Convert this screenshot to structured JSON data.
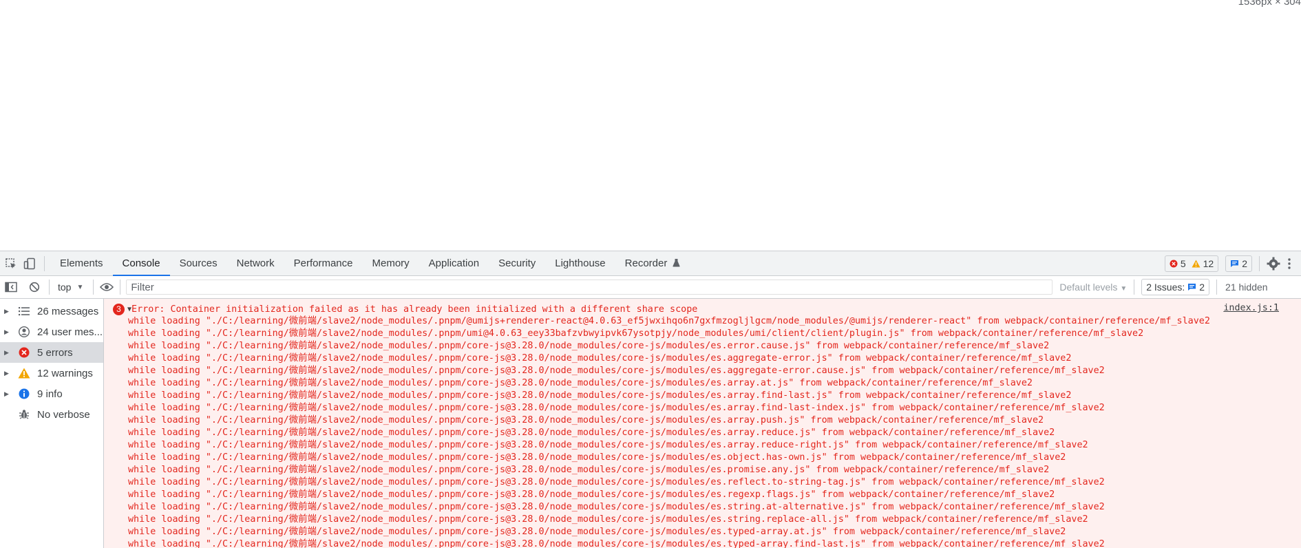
{
  "page": {
    "viewport_dims": "1536px × 304"
  },
  "tabs": {
    "items": [
      {
        "label": "Elements"
      },
      {
        "label": "Console"
      },
      {
        "label": "Sources"
      },
      {
        "label": "Network"
      },
      {
        "label": "Performance"
      },
      {
        "label": "Memory"
      },
      {
        "label": "Application"
      },
      {
        "label": "Security"
      },
      {
        "label": "Lighthouse"
      },
      {
        "label": "Recorder"
      }
    ],
    "active": "Console",
    "error_count": "5",
    "warning_count": "12",
    "message_count": "2"
  },
  "filterbar": {
    "context": "top",
    "filter_placeholder": "Filter",
    "levels": "Default levels",
    "issues_label": "2 Issues:",
    "issues_count": "2",
    "hidden": "21 hidden"
  },
  "sidebar": {
    "items": [
      {
        "label": "26 messages",
        "icon": "list-icon"
      },
      {
        "label": "24 user mes...",
        "icon": "user-icon"
      },
      {
        "label": "5 errors",
        "icon": "error-icon"
      },
      {
        "label": "12 warnings",
        "icon": "warning-icon"
      },
      {
        "label": "9 info",
        "icon": "info-icon"
      },
      {
        "label": "No verbose",
        "icon": "bug-icon"
      }
    ]
  },
  "console": {
    "error_repeat": "3",
    "error_message": "Error: Container initialization failed as it has already been initialized with a different share scope",
    "source": "index.js:1",
    "lines": [
      "while loading \"./C:/learning/微前端/slave2/node_modules/.pnpm/@umijs+renderer-react@4.0.63_ef5jwxihqo6n7gxfmzogljlgcm/node_modules/@umijs/renderer-react\" from webpack/container/reference/mf_slave2",
      "while loading \"./C:/learning/微前端/slave2/node_modules/.pnpm/umi@4.0.63_eey33bafzvbwyipvk67ysotpjy/node_modules/umi/client/client/plugin.js\" from webpack/container/reference/mf_slave2",
      "while loading \"./C:/learning/微前端/slave2/node_modules/.pnpm/core-js@3.28.0/node_modules/core-js/modules/es.error.cause.js\" from webpack/container/reference/mf_slave2",
      "while loading \"./C:/learning/微前端/slave2/node_modules/.pnpm/core-js@3.28.0/node_modules/core-js/modules/es.aggregate-error.js\" from webpack/container/reference/mf_slave2",
      "while loading \"./C:/learning/微前端/slave2/node_modules/.pnpm/core-js@3.28.0/node_modules/core-js/modules/es.aggregate-error.cause.js\" from webpack/container/reference/mf_slave2",
      "while loading \"./C:/learning/微前端/slave2/node_modules/.pnpm/core-js@3.28.0/node_modules/core-js/modules/es.array.at.js\" from webpack/container/reference/mf_slave2",
      "while loading \"./C:/learning/微前端/slave2/node_modules/.pnpm/core-js@3.28.0/node_modules/core-js/modules/es.array.find-last.js\" from webpack/container/reference/mf_slave2",
      "while loading \"./C:/learning/微前端/slave2/node_modules/.pnpm/core-js@3.28.0/node_modules/core-js/modules/es.array.find-last-index.js\" from webpack/container/reference/mf_slave2",
      "while loading \"./C:/learning/微前端/slave2/node_modules/.pnpm/core-js@3.28.0/node_modules/core-js/modules/es.array.push.js\" from webpack/container/reference/mf_slave2",
      "while loading \"./C:/learning/微前端/slave2/node_modules/.pnpm/core-js@3.28.0/node_modules/core-js/modules/es.array.reduce.js\" from webpack/container/reference/mf_slave2",
      "while loading \"./C:/learning/微前端/slave2/node_modules/.pnpm/core-js@3.28.0/node_modules/core-js/modules/es.array.reduce-right.js\" from webpack/container/reference/mf_slave2",
      "while loading \"./C:/learning/微前端/slave2/node_modules/.pnpm/core-js@3.28.0/node_modules/core-js/modules/es.object.has-own.js\" from webpack/container/reference/mf_slave2",
      "while loading \"./C:/learning/微前端/slave2/node_modules/.pnpm/core-js@3.28.0/node_modules/core-js/modules/es.promise.any.js\" from webpack/container/reference/mf_slave2",
      "while loading \"./C:/learning/微前端/slave2/node_modules/.pnpm/core-js@3.28.0/node_modules/core-js/modules/es.reflect.to-string-tag.js\" from webpack/container/reference/mf_slave2",
      "while loading \"./C:/learning/微前端/slave2/node_modules/.pnpm/core-js@3.28.0/node_modules/core-js/modules/es.regexp.flags.js\" from webpack/container/reference/mf_slave2",
      "while loading \"./C:/learning/微前端/slave2/node_modules/.pnpm/core-js@3.28.0/node_modules/core-js/modules/es.string.at-alternative.js\" from webpack/container/reference/mf_slave2",
      "while loading \"./C:/learning/微前端/slave2/node_modules/.pnpm/core-js@3.28.0/node_modules/core-js/modules/es.string.replace-all.js\" from webpack/container/reference/mf_slave2",
      "while loading \"./C:/learning/微前端/slave2/node_modules/.pnpm/core-js@3.28.0/node_modules/core-js/modules/es.typed-array.at.js\" from webpack/container/reference/mf_slave2",
      "while loading \"./C:/learning/微前端/slave2/node_modules/.pnpm/core-js@3.28.0/node_modules/core-js/modules/es.typed-array.find-last.js\" from webpack/container/reference/mf_slave2"
    ]
  }
}
